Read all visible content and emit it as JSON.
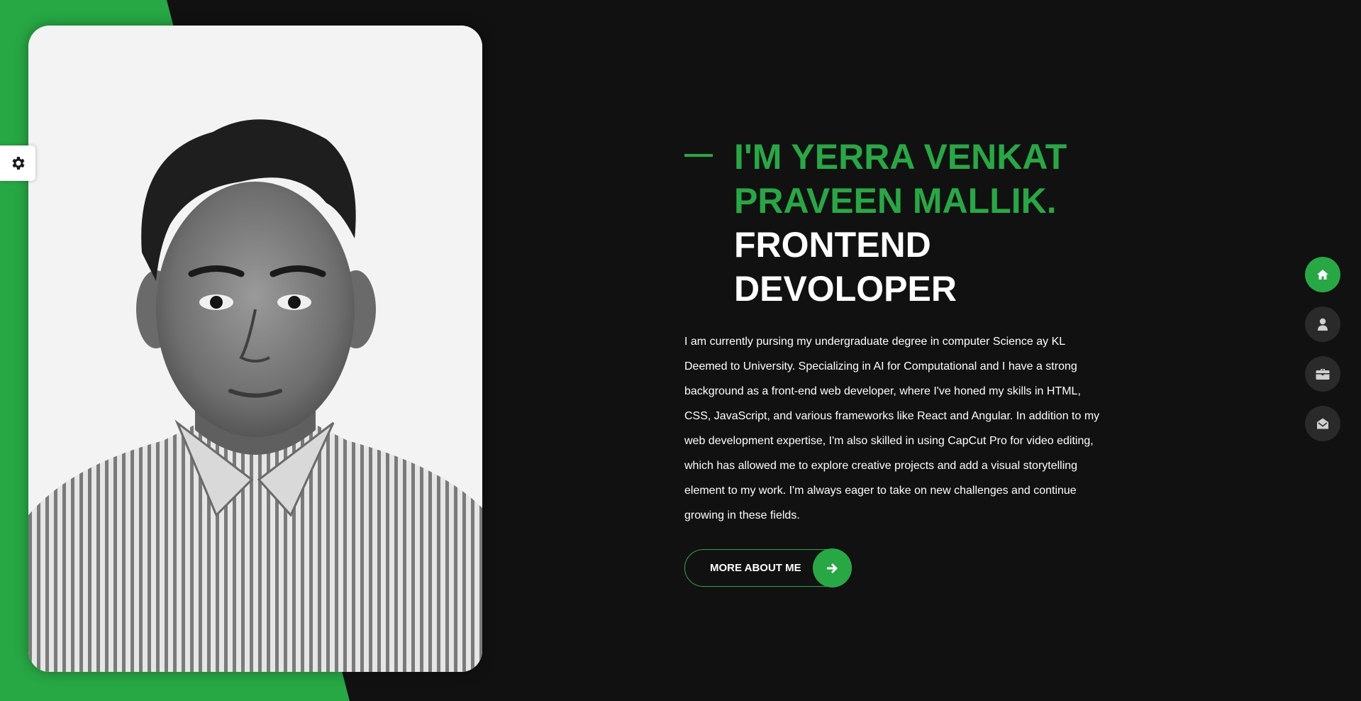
{
  "theme": {
    "accent": "#27a844",
    "background": "#111111",
    "nav_button_bg": "#2b2a2a",
    "text": "#ffffff"
  },
  "settings": {
    "icon": "gear-icon"
  },
  "hero": {
    "name_line_1": "I'M YERRA VENKAT",
    "name_line_2": "PRAVEEN MALLIK.",
    "role_line_1": "FRONTEND",
    "role_line_2": "DEVOLOPER",
    "bio": "I am currently pursing my undergraduate degree in computer Science ay KL Deemed to University. Specializing in AI for Computational and I have a strong background as a front-end web developer, where I've honed my skills in HTML, CSS, JavaScript, and various frameworks like React and Angular. In addition to my web development expertise, I'm also skilled in using CapCut Pro for video editing, which has allowed me to explore creative projects and add a visual storytelling element to my work. I'm always eager to take on new challenges and continue growing in these fields.",
    "cta_label": "MORE ABOUT ME",
    "cta_icon": "arrow-right-icon"
  },
  "side_nav": {
    "items": [
      {
        "icon": "home-icon",
        "active": true
      },
      {
        "icon": "user-icon",
        "active": false
      },
      {
        "icon": "briefcase-icon",
        "active": false
      },
      {
        "icon": "envelope-open-icon",
        "active": false
      }
    ]
  }
}
